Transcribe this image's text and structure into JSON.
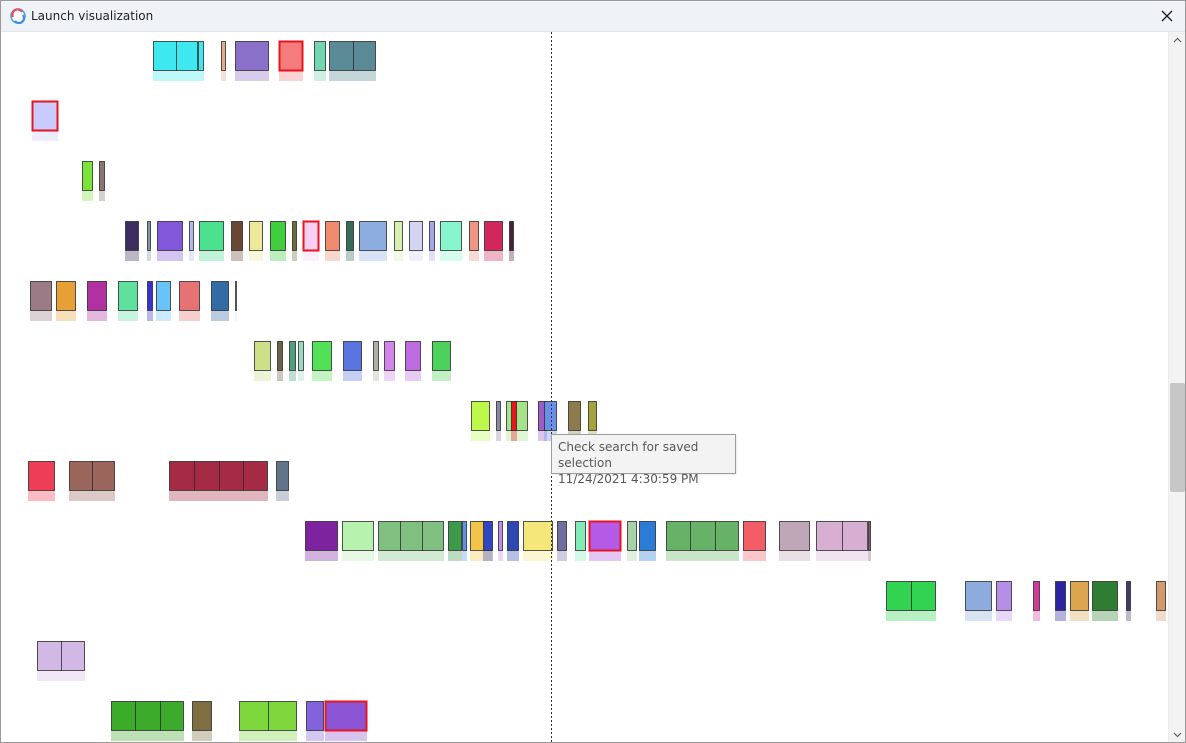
{
  "window": {
    "title": "Launch visualization"
  },
  "tooltip": {
    "line1": "Check search for saved selection",
    "line2": "11/24/2021 4:30:59 PM"
  },
  "icons": {
    "app": "app-logo-icon",
    "close": "close-icon",
    "scroll_up": "chevron-up-icon",
    "scroll_down": "chevron-down-icon"
  },
  "colors": {
    "selection_border": "#e8141e",
    "timeline_line": "#333333",
    "titlebar_bg": "#eff3f8"
  },
  "rows": [
    [
      [
        152,
        45,
        "#3ee8ef"
      ],
      [
        197,
        6,
        "#3ee8ef"
      ],
      [
        220,
        5,
        "#e3a98a"
      ],
      [
        234,
        34,
        "#8a70c8"
      ],
      [
        278,
        24,
        "#f47c7c",
        "sel"
      ],
      [
        313,
        12,
        "#74d6b0"
      ],
      [
        328,
        47,
        "#5a8a95"
      ]
    ],
    [
      [
        31,
        26,
        "#c9cbff",
        "sel"
      ]
    ],
    [
      [
        81,
        11,
        "#7ce33a"
      ],
      [
        98,
        6,
        "#8e7470"
      ]
    ],
    [
      [
        124,
        14,
        "#3b2d60"
      ],
      [
        146,
        4,
        "#7e98a5"
      ],
      [
        156,
        26,
        "#8257d9"
      ],
      [
        188,
        5,
        "#b3b9ee"
      ],
      [
        198,
        25,
        "#4be08e"
      ],
      [
        230,
        12,
        "#6a4734"
      ],
      [
        248,
        14,
        "#eee89a"
      ],
      [
        269,
        16,
        "#40cd3e"
      ],
      [
        291,
        5,
        "#6d6d38"
      ],
      [
        302,
        16,
        "#f6cff3",
        "sel"
      ],
      [
        324,
        15,
        "#ef8c6f"
      ],
      [
        345,
        8,
        "#366b5c"
      ],
      [
        358,
        28,
        "#8dace0"
      ],
      [
        393,
        9,
        "#d8f0b0"
      ],
      [
        408,
        14,
        "#d4d5f3"
      ],
      [
        428,
        6,
        "#a6a6e6"
      ],
      [
        439,
        22,
        "#87f5cd"
      ],
      [
        468,
        10,
        "#ef9581"
      ],
      [
        483,
        19,
        "#d1275c"
      ],
      [
        508,
        5,
        "#4b1f3a"
      ]
    ],
    [
      [
        29,
        22,
        "#9b7c86"
      ],
      [
        55,
        20,
        "#e7a035"
      ],
      [
        86,
        20,
        "#b131a1"
      ],
      [
        117,
        20,
        "#5fe09c"
      ],
      [
        146,
        6,
        "#3930d0"
      ],
      [
        155,
        15,
        "#68c3f8"
      ],
      [
        178,
        21,
        "#e57373"
      ],
      [
        210,
        18,
        "#336ba5"
      ],
      [
        234,
        2,
        "#dfe3e6"
      ]
    ],
    [
      [
        253,
        17,
        "#cce08a"
      ],
      [
        276,
        6,
        "#6a6347"
      ],
      [
        288,
        7,
        "#4e9e80"
      ],
      [
        297,
        6,
        "#9ad8c4"
      ],
      [
        311,
        20,
        "#52e057"
      ],
      [
        342,
        19,
        "#5a74e0"
      ],
      [
        372,
        6,
        "#aeb0a5"
      ],
      [
        383,
        11,
        "#d285e8"
      ],
      [
        404,
        16,
        "#bd6bdf"
      ],
      [
        431,
        19,
        "#4cd15c"
      ]
    ],
    [
      [
        470,
        19,
        "#bef84a"
      ],
      [
        495,
        5,
        "#8a86a6"
      ],
      [
        505,
        22,
        "#a6e28a"
      ],
      [
        510,
        6,
        "#e8141e"
      ],
      [
        537,
        9,
        "#9e5bc6"
      ],
      [
        543,
        13,
        "#6a8fe8"
      ],
      [
        567,
        13,
        "#8d7a4d"
      ],
      [
        587,
        9,
        "#a5a13d"
      ]
    ],
    [
      [
        27,
        27,
        "#ee3e55"
      ],
      [
        68,
        46,
        "#9a655a"
      ],
      [
        168,
        99,
        "#a52b45"
      ],
      [
        275,
        13,
        "#627489"
      ]
    ],
    [
      [
        304,
        33,
        "#7e23a0"
      ],
      [
        341,
        32,
        "#b7f2ae"
      ],
      [
        377,
        66,
        "#7fc080"
      ],
      [
        447,
        14,
        "#3c9a4a"
      ],
      [
        461,
        5,
        "#5d92e8"
      ],
      [
        469,
        22,
        "#f2c54a"
      ],
      [
        482,
        10,
        "#3046c0"
      ],
      [
        497,
        5,
        "#c28be6"
      ],
      [
        506,
        12,
        "#2c49b3"
      ],
      [
        522,
        30,
        "#f6e77a"
      ],
      [
        556,
        10,
        "#6e6fa0"
      ],
      [
        574,
        11,
        "#83ebb8"
      ],
      [
        588,
        32,
        "#b35be6",
        "sel"
      ],
      [
        626,
        10,
        "#a7d2a7"
      ],
      [
        638,
        17,
        "#2a7cd6"
      ],
      [
        665,
        73,
        "#66b266"
      ],
      [
        742,
        23,
        "#f25d66"
      ],
      [
        778,
        31,
        "#c0a7b7"
      ],
      [
        815,
        52,
        "#d6afd2"
      ],
      [
        867,
        3,
        "#895578"
      ]
    ],
    [
      [
        885,
        50,
        "#31d350"
      ],
      [
        964,
        27,
        "#8dabdc"
      ],
      [
        995,
        16,
        "#b68ee6"
      ],
      [
        1032,
        7,
        "#d5389c"
      ],
      [
        1054,
        11,
        "#2c23a0"
      ],
      [
        1069,
        19,
        "#dba64f"
      ],
      [
        1091,
        26,
        "#2f7d32"
      ],
      [
        1125,
        5,
        "#42386a"
      ],
      [
        1155,
        10,
        "#d29a6c"
      ]
    ],
    [
      [
        36,
        48,
        "#d2b8e5"
      ]
    ],
    [
      [
        110,
        73,
        "#3caa2a"
      ],
      [
        191,
        20,
        "#7e6e42"
      ],
      [
        238,
        58,
        "#7cd63c"
      ],
      [
        305,
        18,
        "#8262dd"
      ],
      [
        324,
        42,
        "#8b54d5",
        "sel"
      ]
    ]
  ]
}
